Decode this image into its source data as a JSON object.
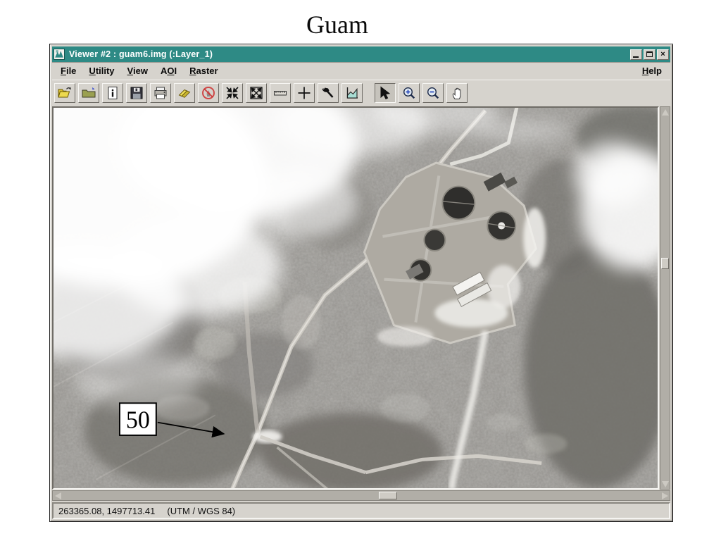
{
  "page": {
    "title": "Guam"
  },
  "window": {
    "title": "Viewer #2 : guam6.img (:Layer_1)",
    "controls": [
      {
        "name": "minimize",
        "glyph": "_"
      },
      {
        "name": "maximize",
        "glyph": "□"
      },
      {
        "name": "close",
        "glyph": "×"
      }
    ]
  },
  "menu_bar": {
    "items": [
      {
        "label": "File",
        "accel": "F"
      },
      {
        "label": "Utility",
        "accel": "U"
      },
      {
        "label": "View",
        "accel": "V"
      },
      {
        "label": "AOI",
        "accel": "O"
      },
      {
        "label": "Raster",
        "accel": "R"
      },
      {
        "label": "Help",
        "accel": "H",
        "right": true
      }
    ]
  },
  "toolbar": {
    "icons": [
      "open-image-icon",
      "open-folder-icon",
      "image-info-icon",
      "save-icon",
      "print-icon",
      "erase-icon",
      "clear-icon",
      "fit-to-frame-icon",
      "zoom-extent-icon",
      "measure-icon",
      "crosshair-icon",
      "tools-icon",
      "profile-icon",
      "pointer-icon",
      "zoom-in-icon",
      "zoom-out-icon",
      "pan-icon"
    ],
    "pressed": "pointer-icon"
  },
  "image": {
    "description": "grayscale aerial photo of Guam wastewater treatment plant with clouds and roads",
    "annotation": {
      "label": "50"
    }
  },
  "status_bar": {
    "coordinates": "263365.08, 1497713.41",
    "projection": "(UTM / WGS 84)"
  },
  "colors": {
    "titlebar_teal": "#2e8a85",
    "chrome_gray": "#d6d3cd"
  }
}
